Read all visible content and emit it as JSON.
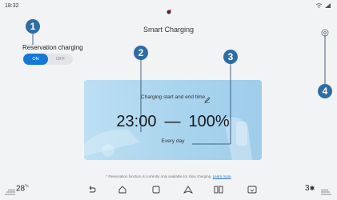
{
  "status_bar": {
    "time": "18:32"
  },
  "header": {
    "title": "Smart Charging"
  },
  "reservation": {
    "label": "Reservation charging",
    "on_label": "ON",
    "off_label": "OFF"
  },
  "card": {
    "caption": "Charging start and end time",
    "start_time": "23:00",
    "separator": "—",
    "end_value": "100%",
    "repeat": "Every day"
  },
  "callouts": [
    "1",
    "2",
    "3",
    "4"
  ],
  "footnote": {
    "text": "* Reservation function is currently only available for slow charging.",
    "link": "Learn more"
  },
  "bottom_bar": {
    "temp_left": "28",
    "temp_left_unit": "°c",
    "temp_right": "3"
  },
  "colors": {
    "accent": "#1479d6",
    "callout": "#2e6da4",
    "card": "#a9d4ee"
  }
}
